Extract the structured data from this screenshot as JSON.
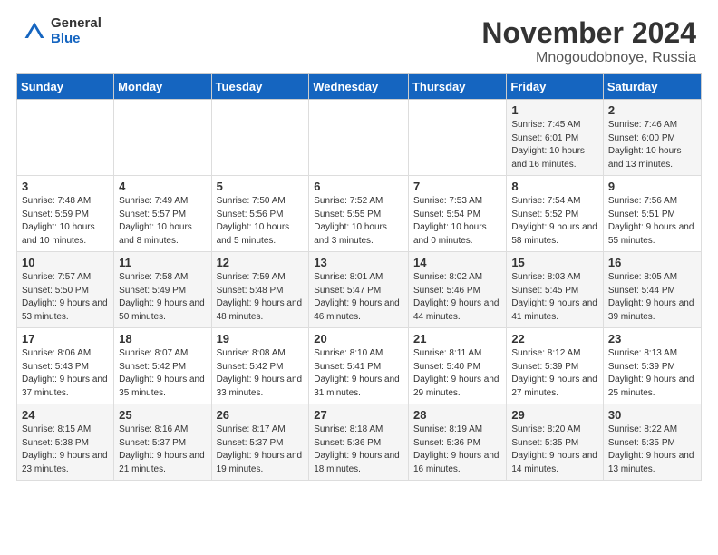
{
  "header": {
    "logo_general": "General",
    "logo_blue": "Blue",
    "month_title": "November 2024",
    "location": "Mnogoudobnoye, Russia"
  },
  "days_of_week": [
    "Sunday",
    "Monday",
    "Tuesday",
    "Wednesday",
    "Thursday",
    "Friday",
    "Saturday"
  ],
  "weeks": [
    [
      {
        "day": "",
        "info": ""
      },
      {
        "day": "",
        "info": ""
      },
      {
        "day": "",
        "info": ""
      },
      {
        "day": "",
        "info": ""
      },
      {
        "day": "",
        "info": ""
      },
      {
        "day": "1",
        "info": "Sunrise: 7:45 AM\nSunset: 6:01 PM\nDaylight: 10 hours and 16 minutes."
      },
      {
        "day": "2",
        "info": "Sunrise: 7:46 AM\nSunset: 6:00 PM\nDaylight: 10 hours and 13 minutes."
      }
    ],
    [
      {
        "day": "3",
        "info": "Sunrise: 7:48 AM\nSunset: 5:59 PM\nDaylight: 10 hours and 10 minutes."
      },
      {
        "day": "4",
        "info": "Sunrise: 7:49 AM\nSunset: 5:57 PM\nDaylight: 10 hours and 8 minutes."
      },
      {
        "day": "5",
        "info": "Sunrise: 7:50 AM\nSunset: 5:56 PM\nDaylight: 10 hours and 5 minutes."
      },
      {
        "day": "6",
        "info": "Sunrise: 7:52 AM\nSunset: 5:55 PM\nDaylight: 10 hours and 3 minutes."
      },
      {
        "day": "7",
        "info": "Sunrise: 7:53 AM\nSunset: 5:54 PM\nDaylight: 10 hours and 0 minutes."
      },
      {
        "day": "8",
        "info": "Sunrise: 7:54 AM\nSunset: 5:52 PM\nDaylight: 9 hours and 58 minutes."
      },
      {
        "day": "9",
        "info": "Sunrise: 7:56 AM\nSunset: 5:51 PM\nDaylight: 9 hours and 55 minutes."
      }
    ],
    [
      {
        "day": "10",
        "info": "Sunrise: 7:57 AM\nSunset: 5:50 PM\nDaylight: 9 hours and 53 minutes."
      },
      {
        "day": "11",
        "info": "Sunrise: 7:58 AM\nSunset: 5:49 PM\nDaylight: 9 hours and 50 minutes."
      },
      {
        "day": "12",
        "info": "Sunrise: 7:59 AM\nSunset: 5:48 PM\nDaylight: 9 hours and 48 minutes."
      },
      {
        "day": "13",
        "info": "Sunrise: 8:01 AM\nSunset: 5:47 PM\nDaylight: 9 hours and 46 minutes."
      },
      {
        "day": "14",
        "info": "Sunrise: 8:02 AM\nSunset: 5:46 PM\nDaylight: 9 hours and 44 minutes."
      },
      {
        "day": "15",
        "info": "Sunrise: 8:03 AM\nSunset: 5:45 PM\nDaylight: 9 hours and 41 minutes."
      },
      {
        "day": "16",
        "info": "Sunrise: 8:05 AM\nSunset: 5:44 PM\nDaylight: 9 hours and 39 minutes."
      }
    ],
    [
      {
        "day": "17",
        "info": "Sunrise: 8:06 AM\nSunset: 5:43 PM\nDaylight: 9 hours and 37 minutes."
      },
      {
        "day": "18",
        "info": "Sunrise: 8:07 AM\nSunset: 5:42 PM\nDaylight: 9 hours and 35 minutes."
      },
      {
        "day": "19",
        "info": "Sunrise: 8:08 AM\nSunset: 5:42 PM\nDaylight: 9 hours and 33 minutes."
      },
      {
        "day": "20",
        "info": "Sunrise: 8:10 AM\nSunset: 5:41 PM\nDaylight: 9 hours and 31 minutes."
      },
      {
        "day": "21",
        "info": "Sunrise: 8:11 AM\nSunset: 5:40 PM\nDaylight: 9 hours and 29 minutes."
      },
      {
        "day": "22",
        "info": "Sunrise: 8:12 AM\nSunset: 5:39 PM\nDaylight: 9 hours and 27 minutes."
      },
      {
        "day": "23",
        "info": "Sunrise: 8:13 AM\nSunset: 5:39 PM\nDaylight: 9 hours and 25 minutes."
      }
    ],
    [
      {
        "day": "24",
        "info": "Sunrise: 8:15 AM\nSunset: 5:38 PM\nDaylight: 9 hours and 23 minutes."
      },
      {
        "day": "25",
        "info": "Sunrise: 8:16 AM\nSunset: 5:37 PM\nDaylight: 9 hours and 21 minutes."
      },
      {
        "day": "26",
        "info": "Sunrise: 8:17 AM\nSunset: 5:37 PM\nDaylight: 9 hours and 19 minutes."
      },
      {
        "day": "27",
        "info": "Sunrise: 8:18 AM\nSunset: 5:36 PM\nDaylight: 9 hours and 18 minutes."
      },
      {
        "day": "28",
        "info": "Sunrise: 8:19 AM\nSunset: 5:36 PM\nDaylight: 9 hours and 16 minutes."
      },
      {
        "day": "29",
        "info": "Sunrise: 8:20 AM\nSunset: 5:35 PM\nDaylight: 9 hours and 14 minutes."
      },
      {
        "day": "30",
        "info": "Sunrise: 8:22 AM\nSunset: 5:35 PM\nDaylight: 9 hours and 13 minutes."
      }
    ]
  ]
}
